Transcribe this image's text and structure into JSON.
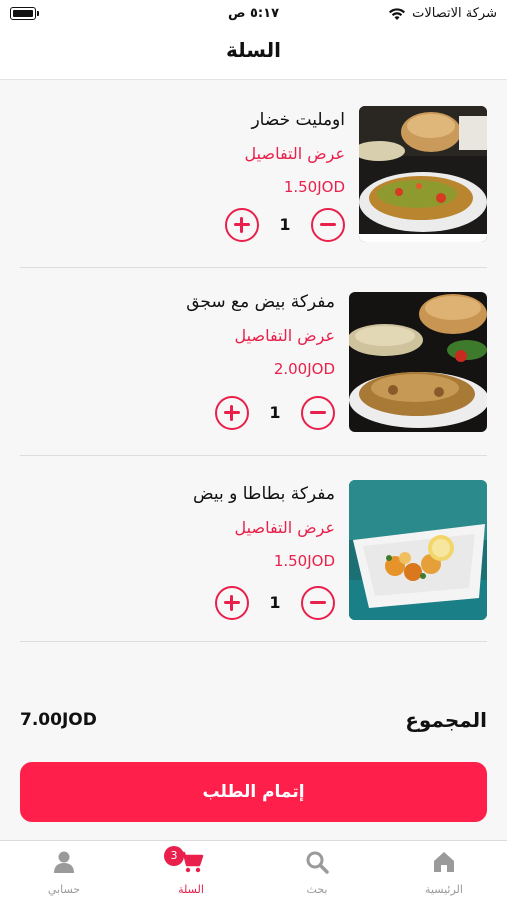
{
  "status": {
    "time": "٥:١٧ ص",
    "carrier": "شركة الاتصالات"
  },
  "header": {
    "title": "السلة"
  },
  "cart": {
    "items": [
      {
        "name": "اومليت خضار",
        "details_label": "عرض التفاصيل",
        "price": "1.50JOD",
        "quantity": "1"
      },
      {
        "name": "مفركة بيض مع سجق",
        "details_label": "عرض التفاصيل",
        "price": "2.00JOD",
        "quantity": "1"
      },
      {
        "name": "مفركة بطاطا و بيض",
        "details_label": "عرض التفاصيل",
        "price": "1.50JOD",
        "quantity": "1"
      }
    ]
  },
  "summary": {
    "total_label": "المجموع",
    "total_value": "7.00JOD",
    "checkout_label": "إتمام الطلب"
  },
  "tabbar": {
    "home": "الرئيسية",
    "search": "بحث",
    "cart": "السلة",
    "cart_badge": "3",
    "account": "حسابي"
  },
  "colors": {
    "accent": "#e8204b",
    "button": "#ff1f4b"
  }
}
